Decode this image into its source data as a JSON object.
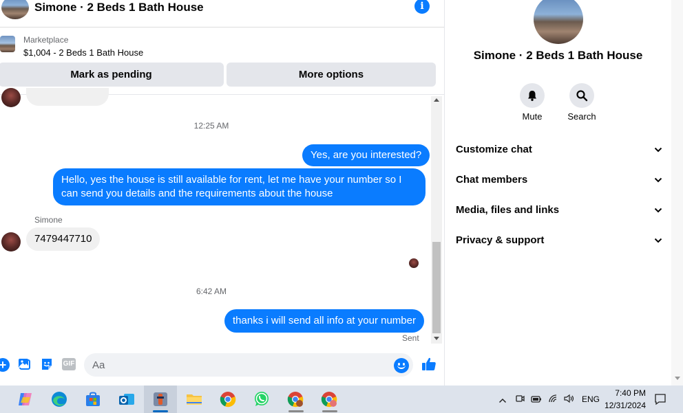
{
  "header": {
    "title": "Simone · 2 Beds 1 Bath House"
  },
  "listing": {
    "source": "Marketplace",
    "price_title": "$1,004 - 2 Beds 1 Bath House",
    "mark_pending_label": "Mark as pending",
    "more_options_label": "More options"
  },
  "messages": {
    "timestamp1": "12:25 AM",
    "msg1": "Yes, are you interested?",
    "msg2": "Hello, yes the house is still available for rent, let me have your number so I can send you details and the requirements about the house",
    "sender_name": "Simone",
    "msg3": "7479447710",
    "timestamp2": "6:42 AM",
    "msg4": "thanks i will send all info at your number",
    "status": "Sent"
  },
  "composer": {
    "placeholder": "Aa"
  },
  "side": {
    "title": "Simone · 2 Beds 1 Bath House",
    "mute_label": "Mute",
    "search_label": "Search",
    "sections": [
      "Customize chat",
      "Chat members",
      "Media, files and links",
      "Privacy & support"
    ]
  },
  "taskbar": {
    "lang": "ENG",
    "time": "7:40 PM",
    "date": "12/31/2024"
  },
  "colors": {
    "messenger_blue": "#0a7cff",
    "bubble_gray": "#f0f0f0",
    "taskbar_bg": "#dde3ec"
  }
}
